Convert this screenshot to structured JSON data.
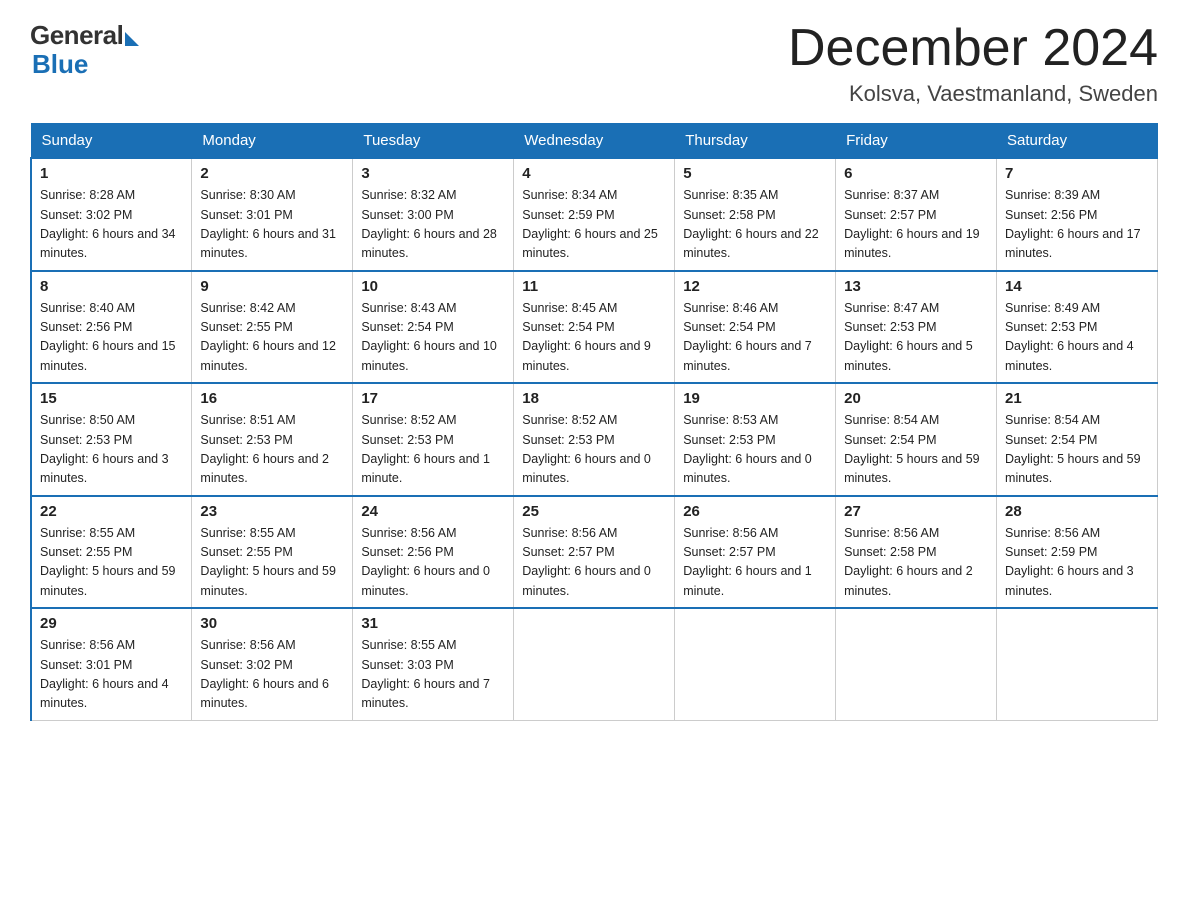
{
  "logo": {
    "general": "General",
    "blue": "Blue"
  },
  "header": {
    "title": "December 2024",
    "subtitle": "Kolsva, Vaestmanland, Sweden"
  },
  "weekdays": [
    "Sunday",
    "Monday",
    "Tuesday",
    "Wednesday",
    "Thursday",
    "Friday",
    "Saturday"
  ],
  "weeks": [
    [
      {
        "day": "1",
        "sunrise": "8:28 AM",
        "sunset": "3:02 PM",
        "daylight": "6 hours and 34 minutes."
      },
      {
        "day": "2",
        "sunrise": "8:30 AM",
        "sunset": "3:01 PM",
        "daylight": "6 hours and 31 minutes."
      },
      {
        "day": "3",
        "sunrise": "8:32 AM",
        "sunset": "3:00 PM",
        "daylight": "6 hours and 28 minutes."
      },
      {
        "day": "4",
        "sunrise": "8:34 AM",
        "sunset": "2:59 PM",
        "daylight": "6 hours and 25 minutes."
      },
      {
        "day": "5",
        "sunrise": "8:35 AM",
        "sunset": "2:58 PM",
        "daylight": "6 hours and 22 minutes."
      },
      {
        "day": "6",
        "sunrise": "8:37 AM",
        "sunset": "2:57 PM",
        "daylight": "6 hours and 19 minutes."
      },
      {
        "day": "7",
        "sunrise": "8:39 AM",
        "sunset": "2:56 PM",
        "daylight": "6 hours and 17 minutes."
      }
    ],
    [
      {
        "day": "8",
        "sunrise": "8:40 AM",
        "sunset": "2:56 PM",
        "daylight": "6 hours and 15 minutes."
      },
      {
        "day": "9",
        "sunrise": "8:42 AM",
        "sunset": "2:55 PM",
        "daylight": "6 hours and 12 minutes."
      },
      {
        "day": "10",
        "sunrise": "8:43 AM",
        "sunset": "2:54 PM",
        "daylight": "6 hours and 10 minutes."
      },
      {
        "day": "11",
        "sunrise": "8:45 AM",
        "sunset": "2:54 PM",
        "daylight": "6 hours and 9 minutes."
      },
      {
        "day": "12",
        "sunrise": "8:46 AM",
        "sunset": "2:54 PM",
        "daylight": "6 hours and 7 minutes."
      },
      {
        "day": "13",
        "sunrise": "8:47 AM",
        "sunset": "2:53 PM",
        "daylight": "6 hours and 5 minutes."
      },
      {
        "day": "14",
        "sunrise": "8:49 AM",
        "sunset": "2:53 PM",
        "daylight": "6 hours and 4 minutes."
      }
    ],
    [
      {
        "day": "15",
        "sunrise": "8:50 AM",
        "sunset": "2:53 PM",
        "daylight": "6 hours and 3 minutes."
      },
      {
        "day": "16",
        "sunrise": "8:51 AM",
        "sunset": "2:53 PM",
        "daylight": "6 hours and 2 minutes."
      },
      {
        "day": "17",
        "sunrise": "8:52 AM",
        "sunset": "2:53 PM",
        "daylight": "6 hours and 1 minute."
      },
      {
        "day": "18",
        "sunrise": "8:52 AM",
        "sunset": "2:53 PM",
        "daylight": "6 hours and 0 minutes."
      },
      {
        "day": "19",
        "sunrise": "8:53 AM",
        "sunset": "2:53 PM",
        "daylight": "6 hours and 0 minutes."
      },
      {
        "day": "20",
        "sunrise": "8:54 AM",
        "sunset": "2:54 PM",
        "daylight": "5 hours and 59 minutes."
      },
      {
        "day": "21",
        "sunrise": "8:54 AM",
        "sunset": "2:54 PM",
        "daylight": "5 hours and 59 minutes."
      }
    ],
    [
      {
        "day": "22",
        "sunrise": "8:55 AM",
        "sunset": "2:55 PM",
        "daylight": "5 hours and 59 minutes."
      },
      {
        "day": "23",
        "sunrise": "8:55 AM",
        "sunset": "2:55 PM",
        "daylight": "5 hours and 59 minutes."
      },
      {
        "day": "24",
        "sunrise": "8:56 AM",
        "sunset": "2:56 PM",
        "daylight": "6 hours and 0 minutes."
      },
      {
        "day": "25",
        "sunrise": "8:56 AM",
        "sunset": "2:57 PM",
        "daylight": "6 hours and 0 minutes."
      },
      {
        "day": "26",
        "sunrise": "8:56 AM",
        "sunset": "2:57 PM",
        "daylight": "6 hours and 1 minute."
      },
      {
        "day": "27",
        "sunrise": "8:56 AM",
        "sunset": "2:58 PM",
        "daylight": "6 hours and 2 minutes."
      },
      {
        "day": "28",
        "sunrise": "8:56 AM",
        "sunset": "2:59 PM",
        "daylight": "6 hours and 3 minutes."
      }
    ],
    [
      {
        "day": "29",
        "sunrise": "8:56 AM",
        "sunset": "3:01 PM",
        "daylight": "6 hours and 4 minutes."
      },
      {
        "day": "30",
        "sunrise": "8:56 AM",
        "sunset": "3:02 PM",
        "daylight": "6 hours and 6 minutes."
      },
      {
        "day": "31",
        "sunrise": "8:55 AM",
        "sunset": "3:03 PM",
        "daylight": "6 hours and 7 minutes."
      },
      null,
      null,
      null,
      null
    ]
  ]
}
